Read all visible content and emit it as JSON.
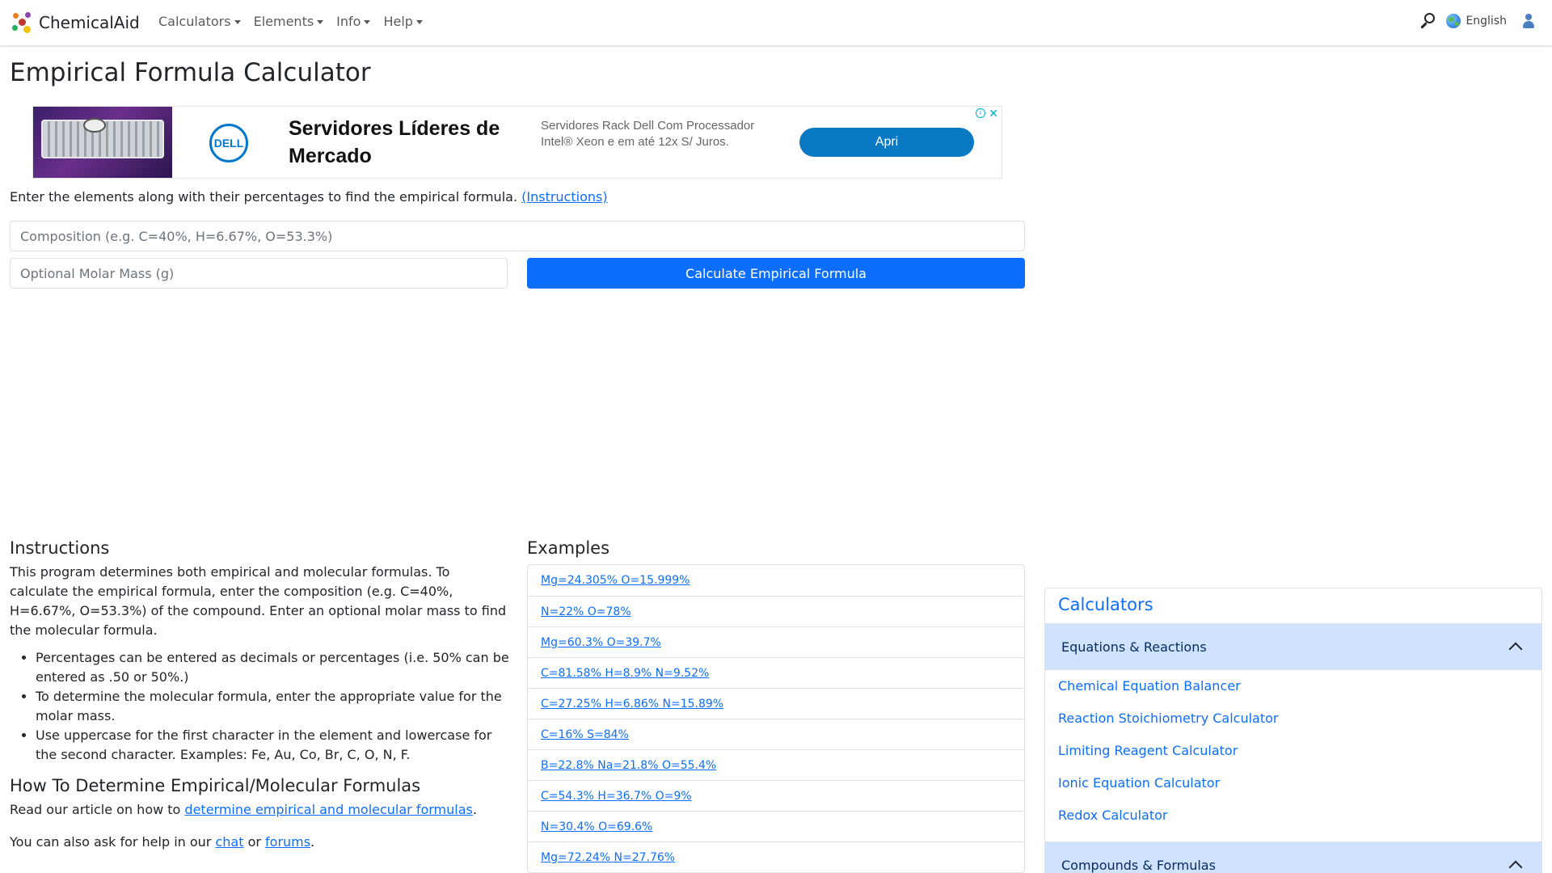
{
  "navbar": {
    "brand": "ChemicalAid",
    "menu": [
      {
        "label": "Calculators"
      },
      {
        "label": "Elements"
      },
      {
        "label": "Info"
      },
      {
        "label": "Help"
      }
    ],
    "language": "English",
    "icons": {
      "search": "search-icon",
      "language": "globe-icon",
      "account": "user-icon"
    }
  },
  "page_title": "Empirical Formula Calculator",
  "ad": {
    "brand_logo": "DELL",
    "headline": "Servidores Líderes de Mercado",
    "body": "Servidores Rack Dell Com Processador Intel® Xeon e em até 12x S/ Juros.",
    "cta": "Apri",
    "info_symbol": "i",
    "close_symbol": "✕"
  },
  "intro": {
    "text": "Enter the elements along with their percentages to find the empirical formula.",
    "link": "(Instructions)"
  },
  "form": {
    "composition_placeholder": "Composition (e.g. C=40%, H=6.67%, O=53.3%)",
    "composition_value": "",
    "molar_mass_placeholder": "Optional Molar Mass (g)",
    "molar_mass_value": "",
    "submit_label": "Calculate Empirical Formula"
  },
  "instructions": {
    "heading": "Instructions",
    "paragraph": "This program determines both empirical and molecular formulas. To calculate the empirical formula, enter the composition (e.g. C=40%, H=6.67%, O=53.3%) of the compound. Enter an optional molar mass to find the molecular formula.",
    "bullets": [
      "Percentages can be entered as decimals or percentages (i.e. 50% can be entered as .50 or 50%.)",
      "To determine the molecular formula, enter the appropriate value for the molar mass.",
      "Use uppercase for the first character in the element and lowercase for the second character. Examples: Fe, Au, Co, Br, C, O, N, F."
    ],
    "howto_heading": "How To Determine Empirical/Molecular Formulas",
    "howto_prefix": "Read our article on how to ",
    "howto_link": "determine empirical and molecular formulas",
    "howto_suffix": ".",
    "help_prefix": "You can also ask for help in our ",
    "help_chat": "chat",
    "help_or": " or ",
    "help_forums": "forums",
    "help_suffix": "."
  },
  "examples": {
    "heading": "Examples",
    "items": [
      "Mg=24.305% O=15.999%",
      "N=22% O=78%",
      "Mg=60.3% O=39.7%",
      "C=81.58% H=8.9% N=9.52%",
      "C=27.25% H=6.86% N=15.89%",
      "C=16% S=84%",
      "B=22.8% Na=21.8% O=55.4%",
      "C=54.3% H=36.7% O=9%",
      "N=30.4% O=69.6%",
      "Mg=72.24% N=27.76%"
    ]
  },
  "sidebar": {
    "title": "Calculators",
    "sections": [
      {
        "label": "Equations & Reactions",
        "links": [
          "Chemical Equation Balancer",
          "Reaction Stoichiometry Calculator",
          "Limiting Reagent Calculator",
          "Ionic Equation Calculator",
          "Redox Calculator"
        ]
      },
      {
        "label": "Compounds & Formulas",
        "links": []
      }
    ]
  }
}
